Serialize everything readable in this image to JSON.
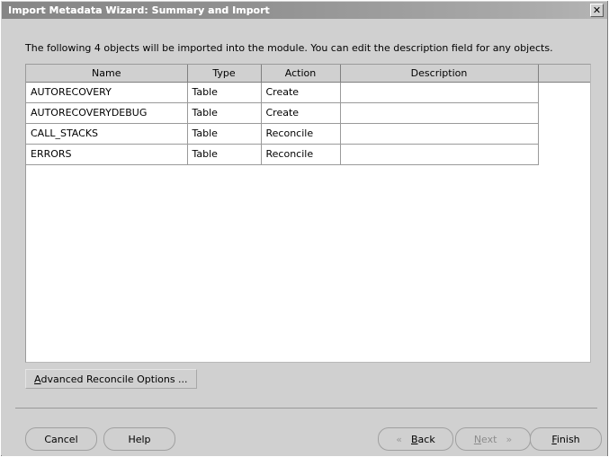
{
  "window": {
    "title": "Import Metadata Wizard: Summary and Import",
    "close_icon": "close-icon",
    "close_glyph": "✕"
  },
  "main": {
    "instruction": "The following 4 objects will be imported into the module. You can edit the description field for any objects.",
    "table": {
      "columns": [
        "Name",
        "Type",
        "Action",
        "Description",
        ""
      ],
      "rows": [
        {
          "name": "AUTORECOVERY",
          "type": "Table",
          "action": "Create",
          "description": ""
        },
        {
          "name": "AUTORECOVERYDEBUG",
          "type": "Table",
          "action": "Create",
          "description": ""
        },
        {
          "name": "CALL_STACKS",
          "type": "Table",
          "action": "Reconcile",
          "description": ""
        },
        {
          "name": "ERRORS",
          "type": "Table",
          "action": "Reconcile",
          "description": ""
        }
      ]
    },
    "advanced_button": {
      "mnemonic": "A",
      "rest": "dvanced Reconcile Options ..."
    }
  },
  "footer": {
    "cancel": "Cancel",
    "help": "Help",
    "back": {
      "mnemonic": "B",
      "rest": "ack",
      "chevron": "«"
    },
    "next": {
      "mnemonic": "N",
      "rest": "ext",
      "chevron": "»",
      "disabled": true
    },
    "finish": {
      "mnemonic": "F",
      "rest": "inish"
    }
  },
  "colors": {
    "dialog_background": "#d0d0d0",
    "titlebar_start": "#868686",
    "titlebar_end": "#b4b4b4",
    "titlebar_text": "#ffffff",
    "panel_background": "#ffffff",
    "grid_line": "#9a9a9a",
    "header_background": "#d0d0d0",
    "disabled_text": "#8c8c8c"
  }
}
